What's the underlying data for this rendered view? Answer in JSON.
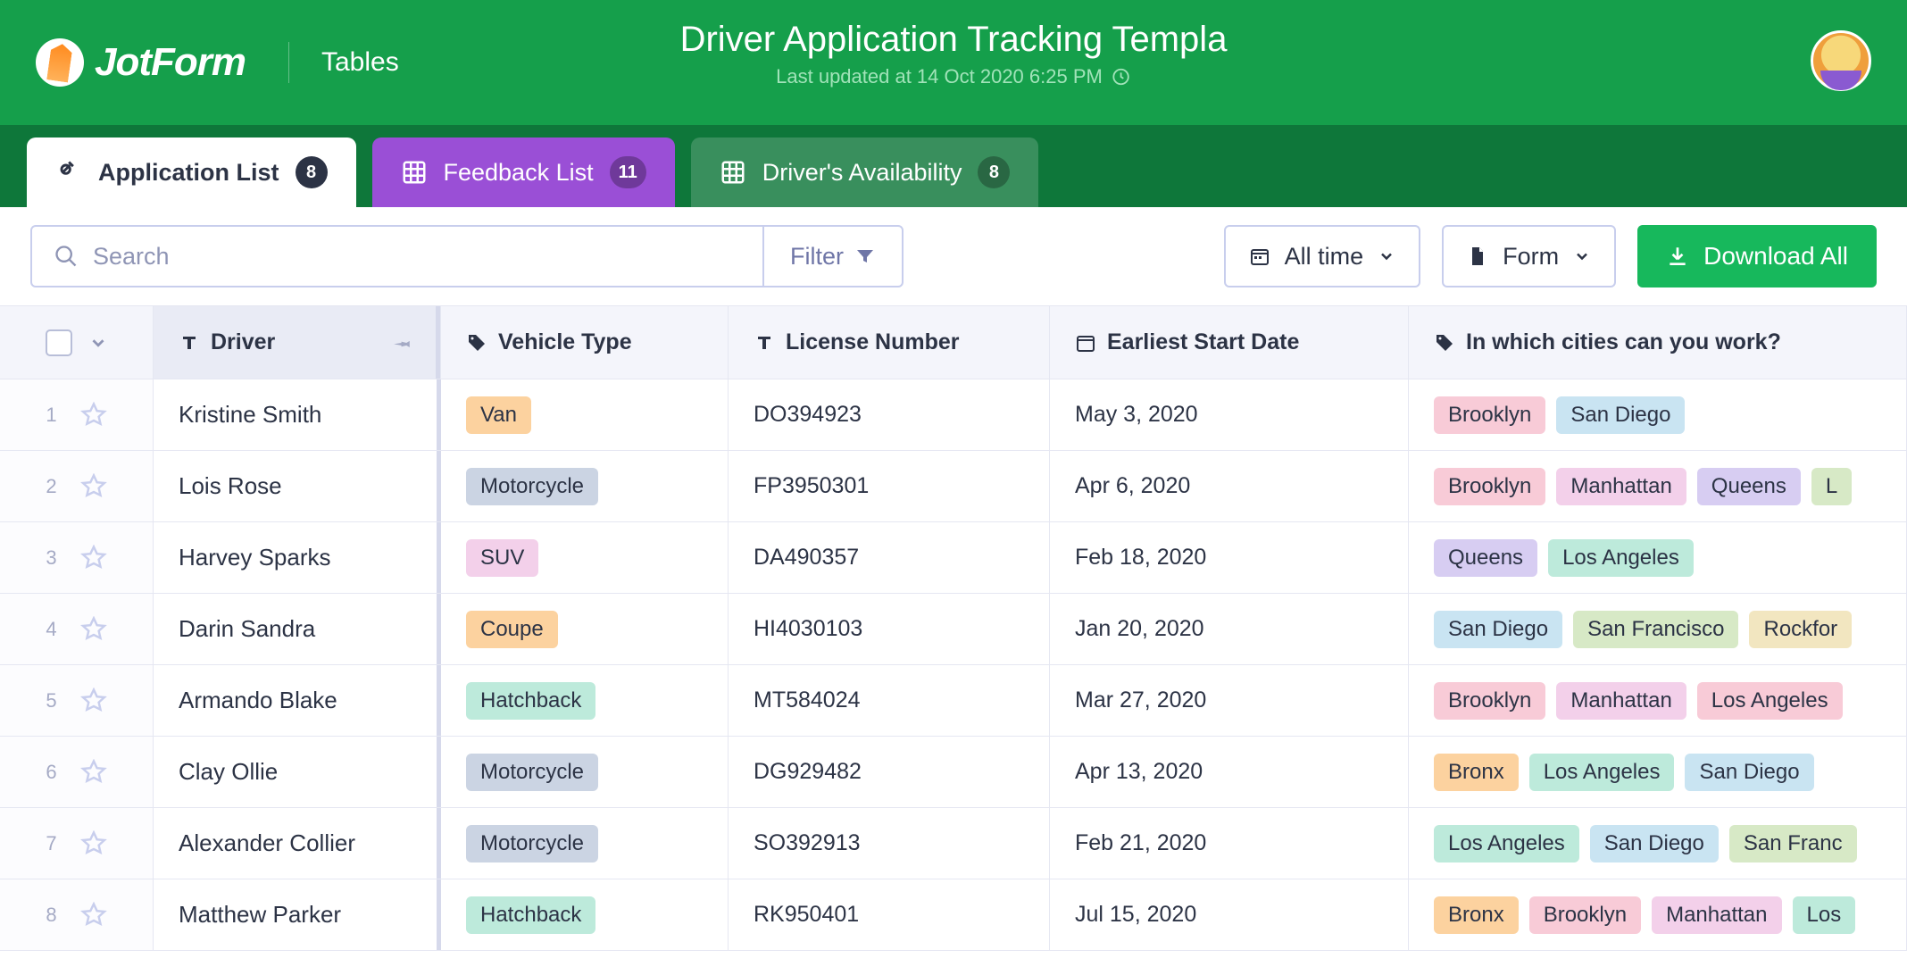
{
  "brand": {
    "name": "JotForm",
    "section": "Tables"
  },
  "page": {
    "title": "Driver Application Tracking Templa",
    "subtitle": "Last updated at 14 Oct 2020 6:25 PM"
  },
  "tabs": [
    {
      "label": "Application List",
      "count": "8",
      "style": "active"
    },
    {
      "label": "Feedback List",
      "count": "11",
      "style": "purple"
    },
    {
      "label": "Driver's Availability",
      "count": "8",
      "style": "green"
    }
  ],
  "toolbar": {
    "search_placeholder": "Search",
    "filter_label": "Filter",
    "time_label": "All time",
    "form_label": "Form",
    "download_label": "Download All"
  },
  "columns": {
    "driver": "Driver",
    "vehicle": "Vehicle Type",
    "license": "License Number",
    "date": "Earliest Start Date",
    "cities": "In which cities can you work?"
  },
  "tag_colors": {
    "Van": "#fcd29f",
    "Motorcycle": "#cbd4e3",
    "SUV": "#f3d0ea",
    "Coupe": "#fcd29f",
    "Hatchback": "#bdeadb",
    "Brooklyn": "#f8cbd7",
    "San Diego": "#c9e4f2",
    "Manhattan": "#f3d0ea",
    "Queens": "#d7cdf2",
    "L": "#d7e9c6",
    "Los Angeles": "#bdeadb",
    "San Francisco": "#d7e9c6",
    "Rockfor": "#f2e6c0",
    "Bronx": "#fcd29f",
    "San Franc": "#d7e9c6",
    "Los Angeles2": "#f8cbd7",
    "Los": "#bdeadb"
  },
  "rows": [
    {
      "n": "1",
      "driver": "Kristine Smith",
      "vehicle": "Van",
      "license": "DO394923",
      "date": "May 3, 2020",
      "cities": [
        "Brooklyn",
        "San Diego"
      ]
    },
    {
      "n": "2",
      "driver": "Lois Rose",
      "vehicle": "Motorcycle",
      "license": "FP3950301",
      "date": "Apr 6, 2020",
      "cities": [
        "Brooklyn",
        "Manhattan",
        "Queens",
        "L"
      ]
    },
    {
      "n": "3",
      "driver": "Harvey Sparks",
      "vehicle": "SUV",
      "license": "DA490357",
      "date": "Feb 18, 2020",
      "cities": [
        "Queens",
        "Los Angeles"
      ]
    },
    {
      "n": "4",
      "driver": "Darin Sandra",
      "vehicle": "Coupe",
      "license": "HI4030103",
      "date": "Jan 20, 2020",
      "cities": [
        "San Diego",
        "San Francisco",
        "Rockfor"
      ]
    },
    {
      "n": "5",
      "driver": "Armando Blake",
      "vehicle": "Hatchback",
      "license": "MT584024",
      "date": "Mar 27, 2020",
      "cities": [
        "Brooklyn",
        "Manhattan",
        "Los Angeles"
      ]
    },
    {
      "n": "6",
      "driver": "Clay Ollie",
      "vehicle": "Motorcycle",
      "license": "DG929482",
      "date": "Apr 13, 2020",
      "cities": [
        "Bronx",
        "Los Angeles",
        "San Diego"
      ]
    },
    {
      "n": "7",
      "driver": "Alexander Collier",
      "vehicle": "Motorcycle",
      "license": "SO392913",
      "date": "Feb 21, 2020",
      "cities": [
        "Los Angeles",
        "San Diego",
        "San Franc"
      ]
    },
    {
      "n": "8",
      "driver": "Matthew Parker",
      "vehicle": "Hatchback",
      "license": "RK950401",
      "date": "Jul 15, 2020",
      "cities": [
        "Bronx",
        "Brooklyn",
        "Manhattan",
        "Los"
      ]
    }
  ],
  "city_color_overrides": {
    "4-2": "Los Angeles2"
  }
}
